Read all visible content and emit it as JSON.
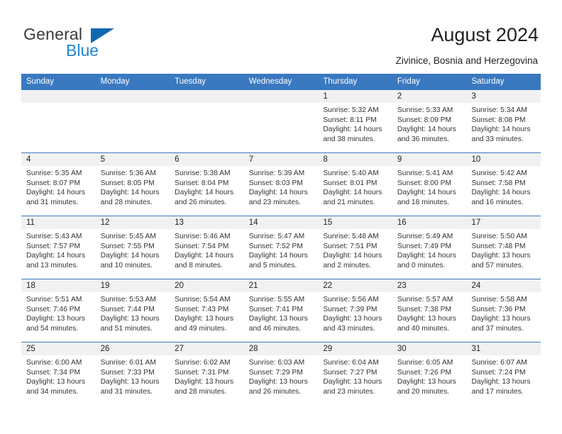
{
  "brand": {
    "word_one": "General",
    "word_two": "Blue",
    "triangle_color": "#1068b3",
    "blue_color": "#1f84d6"
  },
  "header": {
    "title": "August 2024",
    "subtitle": "Zivinice, Bosnia and Herzegovina",
    "accent_color": "#3a79c0"
  },
  "calendar": {
    "weekdays": [
      "Sunday",
      "Monday",
      "Tuesday",
      "Wednesday",
      "Thursday",
      "Friday",
      "Saturday"
    ],
    "weeks": [
      [
        {
          "day": "",
          "sunrise": "",
          "sunset": "",
          "daylight": ""
        },
        {
          "day": "",
          "sunrise": "",
          "sunset": "",
          "daylight": ""
        },
        {
          "day": "",
          "sunrise": "",
          "sunset": "",
          "daylight": ""
        },
        {
          "day": "",
          "sunrise": "",
          "sunset": "",
          "daylight": ""
        },
        {
          "day": "1",
          "sunrise": "Sunrise: 5:32 AM",
          "sunset": "Sunset: 8:11 PM",
          "daylight": "Daylight: 14 hours and 38 minutes."
        },
        {
          "day": "2",
          "sunrise": "Sunrise: 5:33 AM",
          "sunset": "Sunset: 8:09 PM",
          "daylight": "Daylight: 14 hours and 36 minutes."
        },
        {
          "day": "3",
          "sunrise": "Sunrise: 5:34 AM",
          "sunset": "Sunset: 8:08 PM",
          "daylight": "Daylight: 14 hours and 33 minutes."
        }
      ],
      [
        {
          "day": "4",
          "sunrise": "Sunrise: 5:35 AM",
          "sunset": "Sunset: 8:07 PM",
          "daylight": "Daylight: 14 hours and 31 minutes."
        },
        {
          "day": "5",
          "sunrise": "Sunrise: 5:36 AM",
          "sunset": "Sunset: 8:05 PM",
          "daylight": "Daylight: 14 hours and 28 minutes."
        },
        {
          "day": "6",
          "sunrise": "Sunrise: 5:38 AM",
          "sunset": "Sunset: 8:04 PM",
          "daylight": "Daylight: 14 hours and 26 minutes."
        },
        {
          "day": "7",
          "sunrise": "Sunrise: 5:39 AM",
          "sunset": "Sunset: 8:03 PM",
          "daylight": "Daylight: 14 hours and 23 minutes."
        },
        {
          "day": "8",
          "sunrise": "Sunrise: 5:40 AM",
          "sunset": "Sunset: 8:01 PM",
          "daylight": "Daylight: 14 hours and 21 minutes."
        },
        {
          "day": "9",
          "sunrise": "Sunrise: 5:41 AM",
          "sunset": "Sunset: 8:00 PM",
          "daylight": "Daylight: 14 hours and 18 minutes."
        },
        {
          "day": "10",
          "sunrise": "Sunrise: 5:42 AM",
          "sunset": "Sunset: 7:58 PM",
          "daylight": "Daylight: 14 hours and 16 minutes."
        }
      ],
      [
        {
          "day": "11",
          "sunrise": "Sunrise: 5:43 AM",
          "sunset": "Sunset: 7:57 PM",
          "daylight": "Daylight: 14 hours and 13 minutes."
        },
        {
          "day": "12",
          "sunrise": "Sunrise: 5:45 AM",
          "sunset": "Sunset: 7:55 PM",
          "daylight": "Daylight: 14 hours and 10 minutes."
        },
        {
          "day": "13",
          "sunrise": "Sunrise: 5:46 AM",
          "sunset": "Sunset: 7:54 PM",
          "daylight": "Daylight: 14 hours and 8 minutes."
        },
        {
          "day": "14",
          "sunrise": "Sunrise: 5:47 AM",
          "sunset": "Sunset: 7:52 PM",
          "daylight": "Daylight: 14 hours and 5 minutes."
        },
        {
          "day": "15",
          "sunrise": "Sunrise: 5:48 AM",
          "sunset": "Sunset: 7:51 PM",
          "daylight": "Daylight: 14 hours and 2 minutes."
        },
        {
          "day": "16",
          "sunrise": "Sunrise: 5:49 AM",
          "sunset": "Sunset: 7:49 PM",
          "daylight": "Daylight: 14 hours and 0 minutes."
        },
        {
          "day": "17",
          "sunrise": "Sunrise: 5:50 AM",
          "sunset": "Sunset: 7:48 PM",
          "daylight": "Daylight: 13 hours and 57 minutes."
        }
      ],
      [
        {
          "day": "18",
          "sunrise": "Sunrise: 5:51 AM",
          "sunset": "Sunset: 7:46 PM",
          "daylight": "Daylight: 13 hours and 54 minutes."
        },
        {
          "day": "19",
          "sunrise": "Sunrise: 5:53 AM",
          "sunset": "Sunset: 7:44 PM",
          "daylight": "Daylight: 13 hours and 51 minutes."
        },
        {
          "day": "20",
          "sunrise": "Sunrise: 5:54 AM",
          "sunset": "Sunset: 7:43 PM",
          "daylight": "Daylight: 13 hours and 49 minutes."
        },
        {
          "day": "21",
          "sunrise": "Sunrise: 5:55 AM",
          "sunset": "Sunset: 7:41 PM",
          "daylight": "Daylight: 13 hours and 46 minutes."
        },
        {
          "day": "22",
          "sunrise": "Sunrise: 5:56 AM",
          "sunset": "Sunset: 7:39 PM",
          "daylight": "Daylight: 13 hours and 43 minutes."
        },
        {
          "day": "23",
          "sunrise": "Sunrise: 5:57 AM",
          "sunset": "Sunset: 7:38 PM",
          "daylight": "Daylight: 13 hours and 40 minutes."
        },
        {
          "day": "24",
          "sunrise": "Sunrise: 5:58 AM",
          "sunset": "Sunset: 7:36 PM",
          "daylight": "Daylight: 13 hours and 37 minutes."
        }
      ],
      [
        {
          "day": "25",
          "sunrise": "Sunrise: 6:00 AM",
          "sunset": "Sunset: 7:34 PM",
          "daylight": "Daylight: 13 hours and 34 minutes."
        },
        {
          "day": "26",
          "sunrise": "Sunrise: 6:01 AM",
          "sunset": "Sunset: 7:33 PM",
          "daylight": "Daylight: 13 hours and 31 minutes."
        },
        {
          "day": "27",
          "sunrise": "Sunrise: 6:02 AM",
          "sunset": "Sunset: 7:31 PM",
          "daylight": "Daylight: 13 hours and 28 minutes."
        },
        {
          "day": "28",
          "sunrise": "Sunrise: 6:03 AM",
          "sunset": "Sunset: 7:29 PM",
          "daylight": "Daylight: 13 hours and 26 minutes."
        },
        {
          "day": "29",
          "sunrise": "Sunrise: 6:04 AM",
          "sunset": "Sunset: 7:27 PM",
          "daylight": "Daylight: 13 hours and 23 minutes."
        },
        {
          "day": "30",
          "sunrise": "Sunrise: 6:05 AM",
          "sunset": "Sunset: 7:26 PM",
          "daylight": "Daylight: 13 hours and 20 minutes."
        },
        {
          "day": "31",
          "sunrise": "Sunrise: 6:07 AM",
          "sunset": "Sunset: 7:24 PM",
          "daylight": "Daylight: 13 hours and 17 minutes."
        }
      ]
    ]
  }
}
